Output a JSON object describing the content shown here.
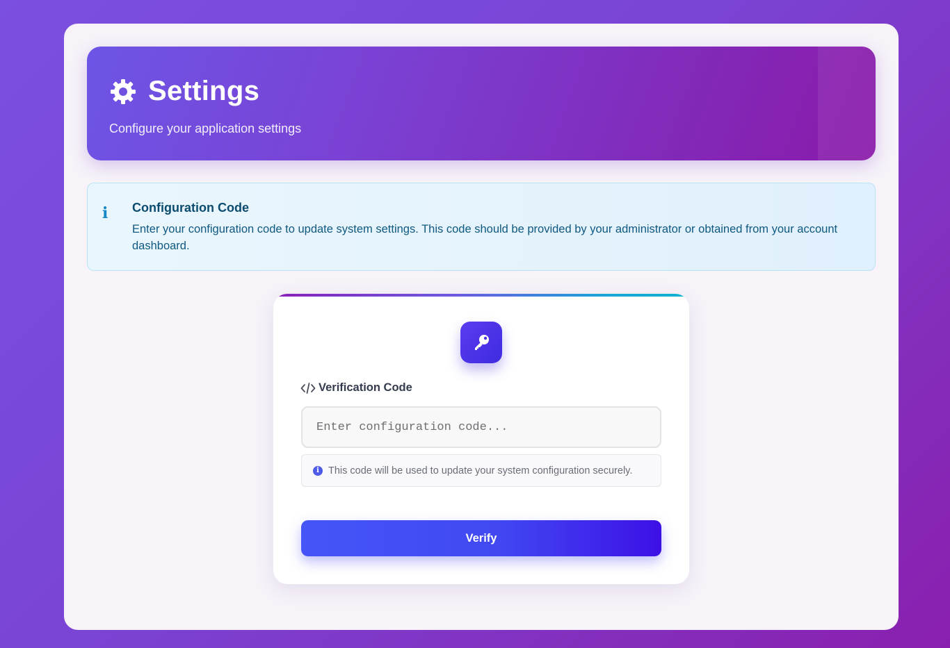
{
  "header": {
    "title": "Settings",
    "subtitle": "Configure your application settings",
    "icon": "gear-icon"
  },
  "info": {
    "icon": "info-icon",
    "title": "Configuration Code",
    "text": "Enter your configuration code to update system settings. This code should be provided by your administrator or obtained from your account dashboard."
  },
  "card": {
    "icon": "key-icon",
    "label_icon": "code-icon",
    "label": "Verification Code",
    "input_placeholder": "Enter configuration code...",
    "input_value": "",
    "hint_icon": "info-circle-icon",
    "hint": "This code will be used to update your system configuration securely.",
    "button_label": "Verify"
  },
  "colors": {
    "background_start": "#7b4fe0",
    "background_end": "#8a1fae",
    "header_start": "#6d55e6",
    "header_end": "#8a1aa9",
    "info_text": "#0f5880",
    "button_start": "#4555f7",
    "button_end": "#3d10e6"
  }
}
